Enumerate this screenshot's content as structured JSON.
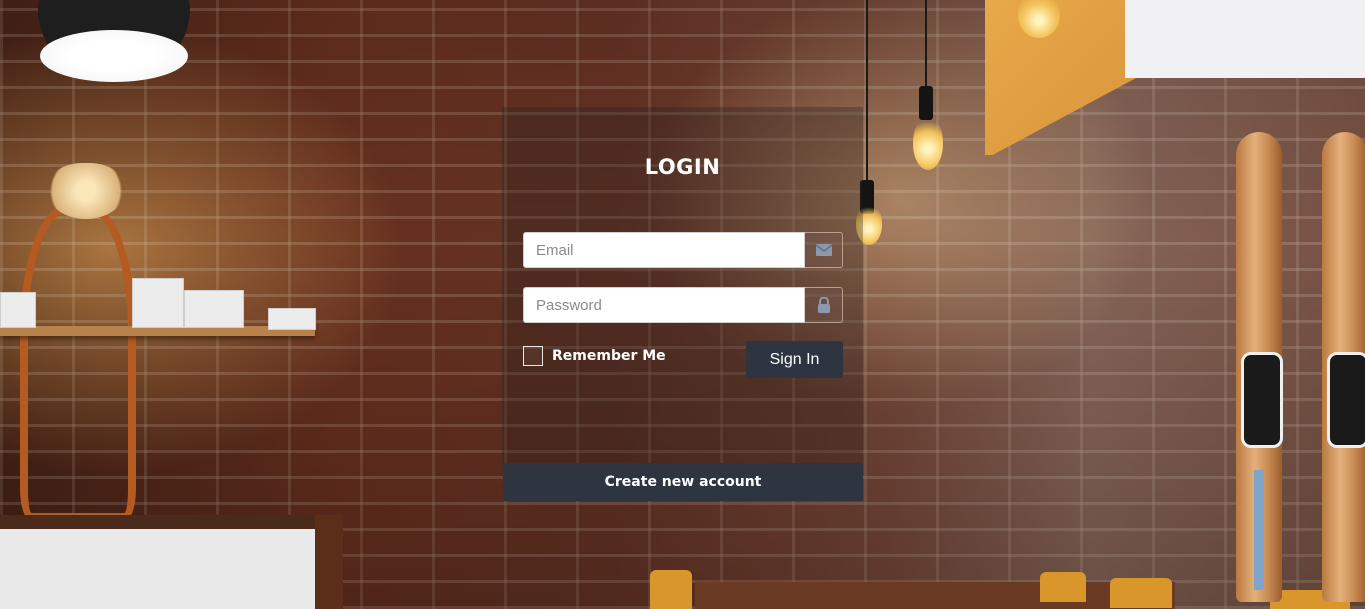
{
  "login": {
    "title": "LOGIN",
    "email": {
      "placeholder": "Email",
      "value": "",
      "icon": "envelope-icon"
    },
    "password": {
      "placeholder": "Password",
      "value": "",
      "icon": "lock-icon"
    },
    "remember_label": "Remember Me",
    "remember_checked": false,
    "signin_label": "Sign In",
    "create_account_label": "Create new account"
  },
  "colors": {
    "button_bg": "#2d3540",
    "title_text": "#ffffff",
    "icon_color": "#8a99ad"
  }
}
